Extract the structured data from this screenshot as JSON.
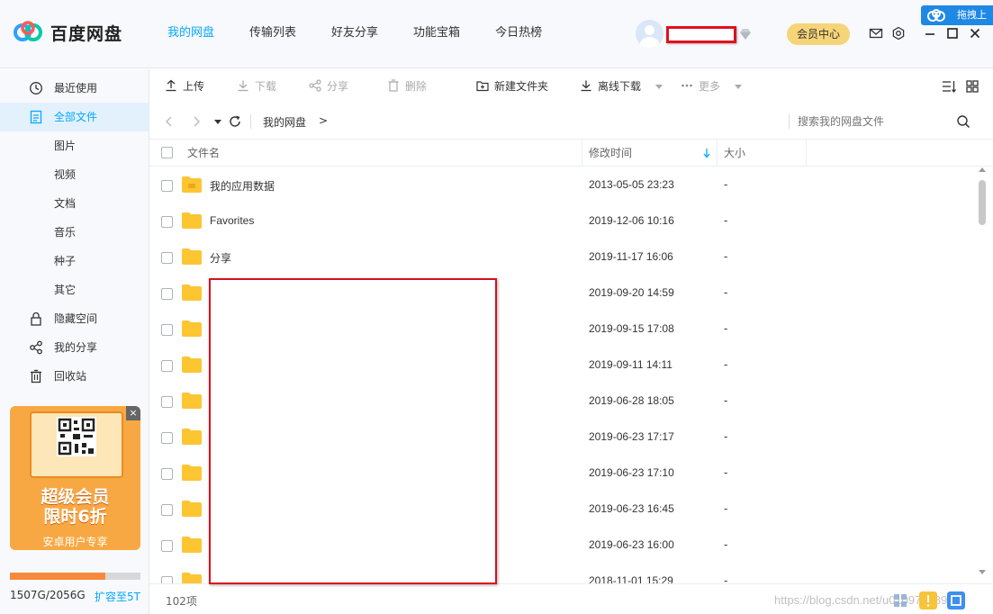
{
  "app": {
    "name": "百度网盘",
    "drag_tip": "拖拽上"
  },
  "nav": {
    "tabs": [
      {
        "label": "我的网盘",
        "active": true
      },
      {
        "label": "传输列表",
        "active": false
      },
      {
        "label": "好友分享",
        "active": false
      },
      {
        "label": "功能宝箱",
        "active": false
      },
      {
        "label": "今日热榜",
        "active": false
      }
    ]
  },
  "header": {
    "vip_center": "会员中心",
    "username": ""
  },
  "sidebar": {
    "items": [
      {
        "label": "最近使用",
        "icon": "clock-icon",
        "active": false
      },
      {
        "label": "全部文件",
        "icon": "document-icon",
        "active": true
      },
      {
        "label": "图片",
        "icon": "",
        "active": false
      },
      {
        "label": "视频",
        "icon": "",
        "active": false
      },
      {
        "label": "文档",
        "icon": "",
        "active": false
      },
      {
        "label": "音乐",
        "icon": "",
        "active": false
      },
      {
        "label": "种子",
        "icon": "",
        "active": false
      },
      {
        "label": "其它",
        "icon": "",
        "active": false
      },
      {
        "label": "隐藏空间",
        "icon": "lock-icon",
        "active": false
      },
      {
        "label": "我的分享",
        "icon": "share-icon",
        "active": false
      },
      {
        "label": "回收站",
        "icon": "trash-icon",
        "active": false
      }
    ],
    "promo": {
      "title_line1": "超级会员",
      "title_line2": "限时6折",
      "subtitle": "安卓用户专享",
      "close": "×"
    },
    "quota": {
      "text": "1507G/2056G",
      "used_fraction": 0.733,
      "expand": "扩容至5T"
    }
  },
  "toolbar": {
    "upload": "上传",
    "download": "下载",
    "share": "分享",
    "delete": "删除",
    "new_folder": "新建文件夹",
    "offline_download": "离线下载",
    "more": "更多"
  },
  "address": {
    "breadcrumb": "我的网盘",
    "separator": ">",
    "search_placeholder": "搜索我的网盘文件"
  },
  "table": {
    "headers": {
      "name": "文件名",
      "modified": "修改时间",
      "size": "大小"
    },
    "rows": [
      {
        "name": "我的应用数据",
        "date": "2013-05-05 23:23",
        "size": "-"
      },
      {
        "name": "Favorites",
        "date": "2019-12-06 10:16",
        "size": "-"
      },
      {
        "name": "分享",
        "date": "2019-11-17 16:06",
        "size": "-"
      },
      {
        "name": "",
        "date": "2019-09-20 14:59",
        "size": "-"
      },
      {
        "name": "",
        "date": "2019-09-15 17:08",
        "size": "-"
      },
      {
        "name": "",
        "date": "2019-09-11 14:11",
        "size": "-"
      },
      {
        "name": "",
        "date": "2019-06-28 18:05",
        "size": "-"
      },
      {
        "name": "",
        "date": "2019-06-23 17:17",
        "size": "-"
      },
      {
        "name": "",
        "date": "2019-06-23 17:10",
        "size": "-"
      },
      {
        "name": "",
        "date": "2019-06-23 16:45",
        "size": "-"
      },
      {
        "name": "",
        "date": "2019-06-23 16:00",
        "size": "-"
      },
      {
        "name": "",
        "date": "2018-11-01 15:29",
        "size": "-"
      }
    ]
  },
  "status": {
    "count": "102项",
    "watermark": "https://blog.csdn.net/u010978889"
  },
  "colors": {
    "accent": "#06a7ff",
    "vip": "#f6d478",
    "folder": "#fcc632",
    "redaction": "#d81020",
    "quota": "#f58a3c"
  }
}
